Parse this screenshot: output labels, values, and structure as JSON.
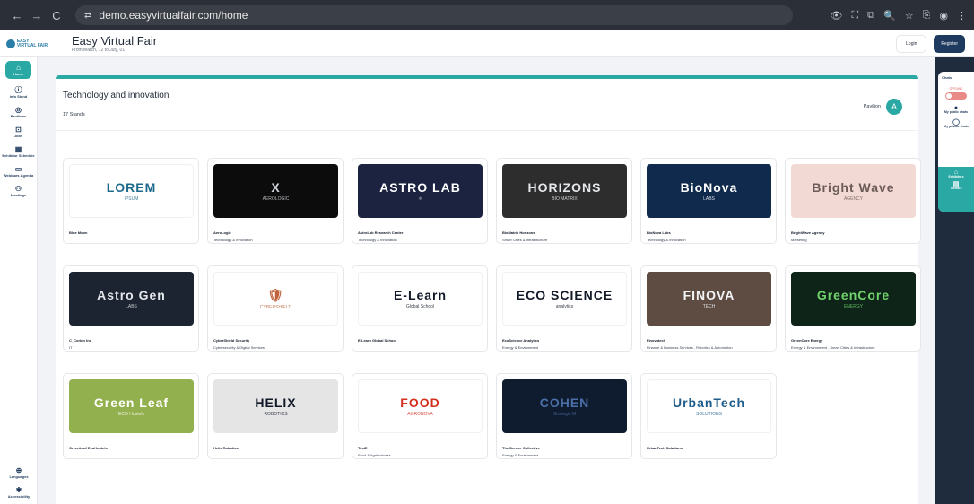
{
  "browser": {
    "back": "←",
    "forward": "→",
    "reload": "C",
    "url": "demo.easyvirtualfair.com/home",
    "tune_icon": "⇄",
    "toolbar_icons": [
      "👁",
      "⛶",
      "⧉",
      "🔍",
      "☆",
      "⎘",
      "◉",
      "⋮"
    ]
  },
  "header": {
    "logo_line1": "EASY",
    "logo_line2": "VIRTUAL FAIR",
    "title": "Easy Virtual Fair",
    "subtitle": "From March, 12 to July, 01",
    "login": "Login",
    "register": "Register"
  },
  "sidebar": {
    "items": [
      {
        "icon": "⌂",
        "label": "Home"
      },
      {
        "icon": "ⓘ",
        "label": "Info Stand"
      },
      {
        "icon": "◎",
        "label": "Pavilions"
      },
      {
        "icon": "⊡",
        "label": "Jobs"
      },
      {
        "icon": "▦",
        "label": "Exhibitor Schedule"
      },
      {
        "icon": "▭",
        "label": "Webinars Agenda"
      },
      {
        "icon": "⚇",
        "label": "Meetings"
      }
    ],
    "bottom": [
      {
        "icon": "⊕",
        "label": "Languages"
      },
      {
        "icon": "✱",
        "label": "Accessibility"
      }
    ]
  },
  "pavilion": {
    "title": "Technology and innovation",
    "count": "17 Stands",
    "label": "Pavilion",
    "avatar": "A"
  },
  "stands": [
    {
      "name": "Blue Moon",
      "category": "",
      "logo": "LOREM",
      "sub": "IPSUM",
      "bg": "#ffffff",
      "fg": "#1e6a8c"
    },
    {
      "name": "AeroLogic",
      "category": "Technology & Innovation",
      "logo": "X",
      "sub": "AEROLOGIC",
      "bg": "#0c0c0c",
      "fg": "#d1d5db"
    },
    {
      "name": "AstroLab Research Center",
      "category": "Technology & Innovation",
      "logo": "ASTRO LAB",
      "sub": "⚛",
      "bg": "#1b2340",
      "fg": "#ffffff"
    },
    {
      "name": "BioMatrix Horizons",
      "category": "Smart Cities & Infrastructure",
      "logo": "HORIZONS",
      "sub": "BIO MATRIX",
      "bg": "#2d2d2d",
      "fg": "#e5e7eb"
    },
    {
      "name": "BioNova Labs",
      "category": "Technology & Innovation",
      "logo": "BioNova",
      "sub": "LABS",
      "bg": "#0f2a4d",
      "fg": "#ffffff"
    },
    {
      "name": "BrightWave Agency",
      "category": "Marketing",
      "logo": "Bright Wave",
      "sub": "AGENCY",
      "bg": "#f3d9d3",
      "fg": "#6b5b58"
    },
    {
      "name": "C_Corbin Inc",
      "category": "IT",
      "logo": "Astro Gen",
      "sub": "LABS",
      "bg": "#1c2432",
      "fg": "#e5e7eb"
    },
    {
      "name": "CyberShield Security",
      "category": "Cybersecurity & Digital Services",
      "logo": "🛡",
      "sub": "CYBERSHIELD",
      "bg": "#ffffff",
      "fg": "#c0623a"
    },
    {
      "name": "E-Learn Global School",
      "category": "",
      "logo": "E-Learn",
      "sub": "Global School",
      "bg": "#ffffff",
      "fg": "#111827"
    },
    {
      "name": "EcoScience Analytics",
      "category": "Energy & Environment",
      "logo": "ECO SCIENCE",
      "sub": "analytics",
      "bg": "#ffffff",
      "fg": "#111827"
    },
    {
      "name": "Finovatech",
      "category": "Finance & Business Services , Robotics & Automation",
      "logo": "FINOVA",
      "sub": "TECH",
      "bg": "#5e4c43",
      "fg": "#f3f4f6"
    },
    {
      "name": "GreenCore Energy",
      "category": "Energy & Environment , Smart Cities & Infrastructure",
      "logo": "GreenCore",
      "sub": "ENERGY",
      "bg": "#0f2419",
      "fg": "#6fd36a"
    },
    {
      "name": "GreenLeaf EcoHostels",
      "category": "",
      "logo": "Green Leaf",
      "sub": "ECO Hostels",
      "bg": "#93b04f",
      "fg": "#ffffff"
    },
    {
      "name": "Helix Robotics",
      "category": "",
      "logo": "HELIX",
      "sub": "ROBOTICS",
      "bg": "#e5e5e5",
      "fg": "#111827"
    },
    {
      "name": "TestE",
      "category": "Food & Agribusiness",
      "logo": "FOOD",
      "sub": "AGRONOVA",
      "bg": "#ffffff",
      "fg": "#d4301e"
    },
    {
      "name": "The Denver Collective",
      "category": "Energy & Environment",
      "logo": "COHEN",
      "sub": "Strategic M",
      "bg": "#0f1b2e",
      "fg": "#4b6fa8"
    },
    {
      "name": "UrbanTech Solutions",
      "category": "",
      "logo": "UrbanTech",
      "sub": "SOLUTIONS",
      "bg": "#ffffff",
      "fg": "#1e5c8a"
    }
  ],
  "chats": {
    "title": "Chats",
    "status": "OFFLINE",
    "items": [
      {
        "icon": "●",
        "label": "My public chats"
      },
      {
        "icon": "◯",
        "label": "My private chats"
      }
    ],
    "exhibitors": {
      "icon": "⌂",
      "label": "Exhibitors"
    },
    "visitors": {
      "icon": "▤",
      "label": "Visitors"
    }
  },
  "colors": {
    "accent": "#2aa8a3",
    "brand": "#1e3a5f"
  }
}
